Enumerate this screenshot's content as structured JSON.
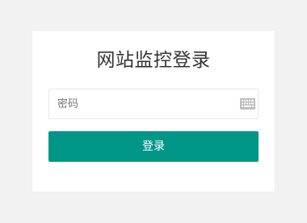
{
  "login": {
    "title": "网站监控登录",
    "password_placeholder": "密码",
    "password_value": "",
    "submit_label": "登录"
  },
  "icons": {
    "keyboard": "keyboard-icon"
  },
  "colors": {
    "background": "#f2f2f2",
    "card": "#ffffff",
    "primary_button": "#009688",
    "button_text": "#ffffff",
    "input_border": "#e6e6e6",
    "keyboard_icon": "#bdbdbd"
  }
}
